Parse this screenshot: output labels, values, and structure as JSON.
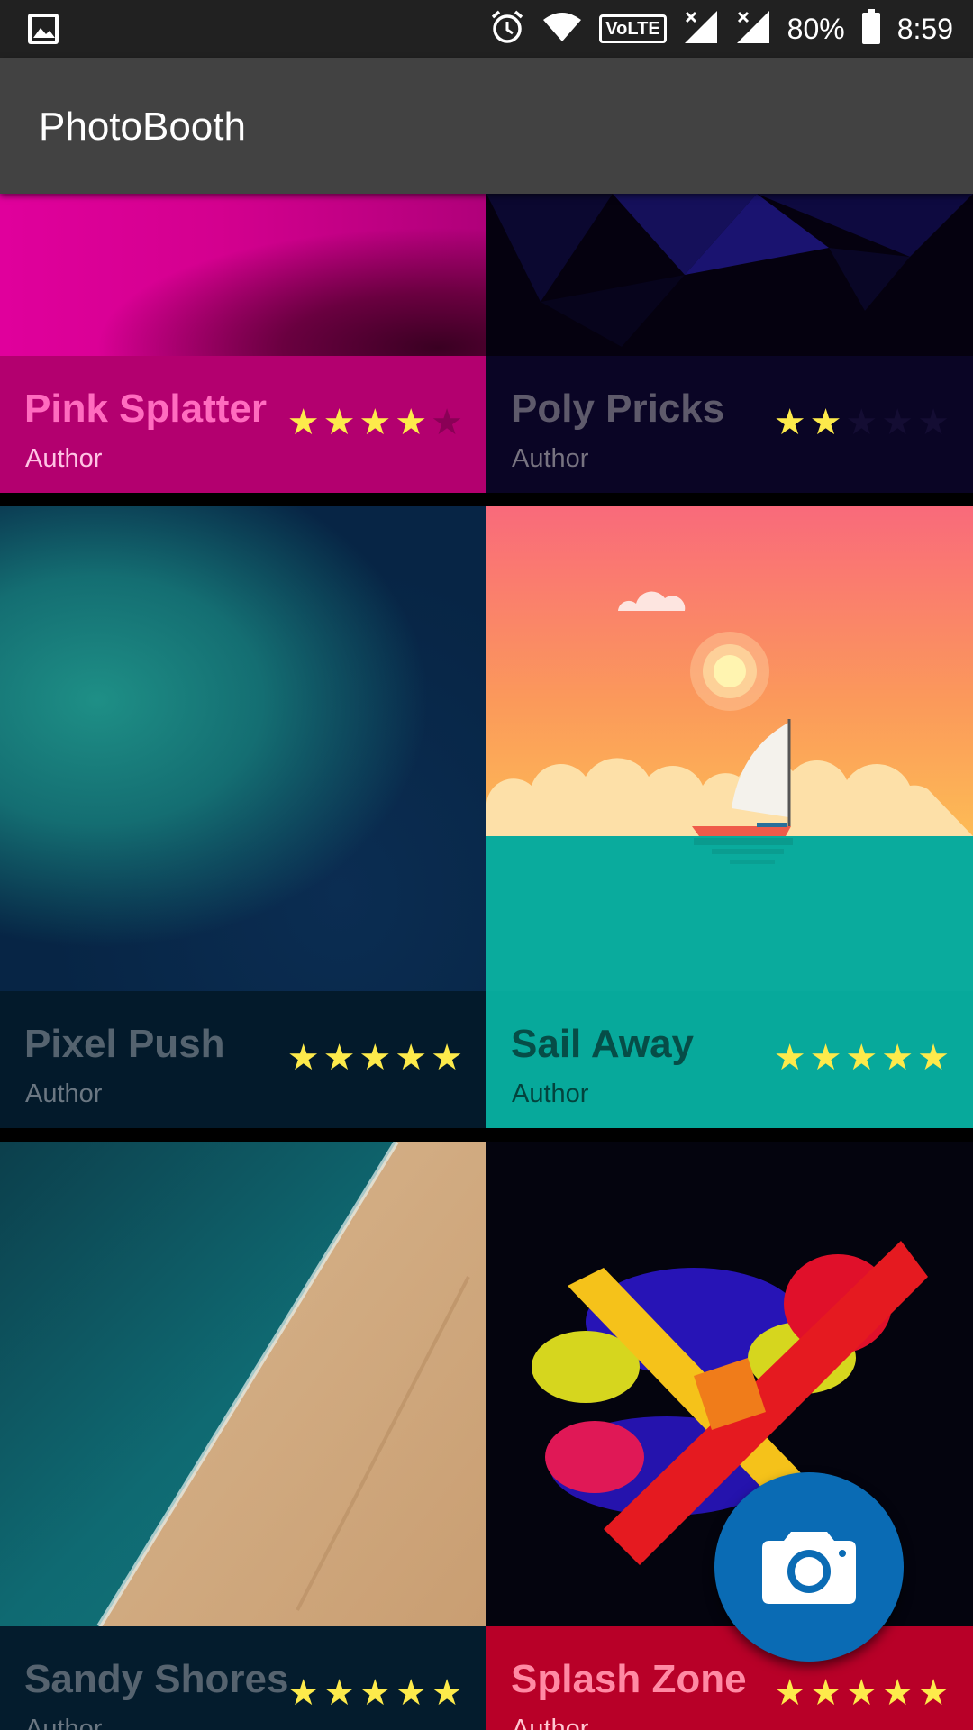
{
  "status_bar": {
    "battery": "80%",
    "time": "8:59",
    "network_badge": "VoLTE",
    "icons": [
      "image-icon",
      "alarm-icon",
      "wifi-icon",
      "volte-badge",
      "signal-icon",
      "signal-icon",
      "battery-icon"
    ]
  },
  "app_bar": {
    "title": "PhotoBooth"
  },
  "cards": [
    {
      "title": "Pink Splatter",
      "author": "Author",
      "rating": 4,
      "footer_color": "#b3006f",
      "title_color": "#ff6cbf",
      "author_color": "#ffc3e4",
      "star_off_color": "#8a0056"
    },
    {
      "title": "Poly Pricks",
      "author": "Author",
      "rating": 2,
      "footer_color": "#0a0525",
      "title_color": "#5e5a6b",
      "author_color": "#777380",
      "star_off_color": "#140d33"
    },
    {
      "title": "Pixel Push",
      "author": "Author",
      "rating": 5,
      "footer_color": "#031a2b",
      "title_color": "#55636f",
      "author_color": "#6b7782",
      "star_off_color": "#0a2a40"
    },
    {
      "title": "Sail Away",
      "author": "Author",
      "rating": 5,
      "footer_color": "#07a99b",
      "title_color": "#064d47",
      "author_color": "#03433d",
      "star_off_color": "#058f83"
    },
    {
      "title": "Sandy Shores",
      "author": "Author",
      "rating": 5,
      "footer_color": "#041c2d",
      "title_color": "#56636f",
      "author_color": "#6b7782",
      "star_off_color": "#0a2a40"
    },
    {
      "title": "Splash Zone",
      "author": "Author",
      "rating": 5,
      "footer_color": "#b80028",
      "title_color": "#ff8aa4",
      "author_color": "#ffc6d2",
      "star_off_color": "#8a0020"
    }
  ],
  "fab": {
    "icon": "camera-icon",
    "color": "#0a6bb4"
  }
}
